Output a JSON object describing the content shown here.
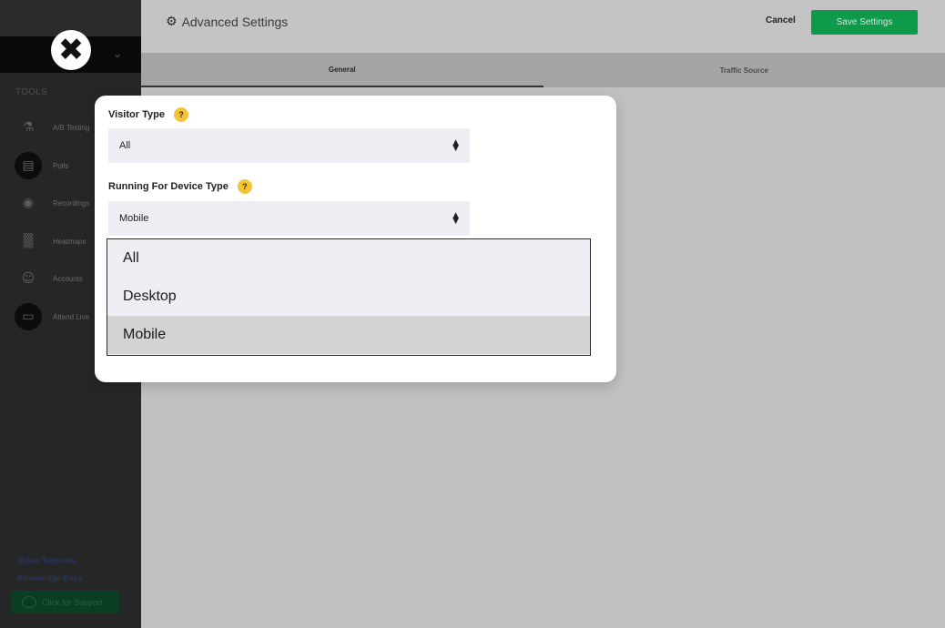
{
  "header": {
    "title": "Advanced Settings",
    "cancel_label": "Cancel",
    "save_label": "Save Settings"
  },
  "tabs": [
    {
      "label": "General",
      "active": true
    },
    {
      "label": "Traffic Source",
      "active": false
    }
  ],
  "sidebar": {
    "tools_heading": "TOOLS",
    "items": [
      {
        "label": "A/B Testing",
        "icon": "ab-testing-icon"
      },
      {
        "label": "Polls",
        "icon": "polls-icon"
      },
      {
        "label": "Recordings",
        "icon": "recordings-icon"
      },
      {
        "label": "Heatmaps",
        "icon": "heatmaps-icon"
      },
      {
        "label": "Accounts",
        "icon": "accounts-icon"
      },
      {
        "label": "Attend Live",
        "icon": "video-icon"
      }
    ],
    "links": {
      "video_tutorials": "Video Tutorials",
      "knowledge_base": "Knowledge Base",
      "support": "Click for Support"
    }
  },
  "modal": {
    "visitor_type": {
      "label": "Visitor Type",
      "help": "?",
      "value": "All"
    },
    "device_type": {
      "label": "Running For Device Type",
      "help": "?",
      "value": "Mobile",
      "options": [
        "All",
        "Desktop",
        "Mobile"
      ],
      "selected_index": 2
    }
  },
  "colors": {
    "save_button": "#0e9a4b",
    "help_badge": "#f3c437",
    "sidebar": "#262626",
    "overlay": "#c1c1c1"
  }
}
